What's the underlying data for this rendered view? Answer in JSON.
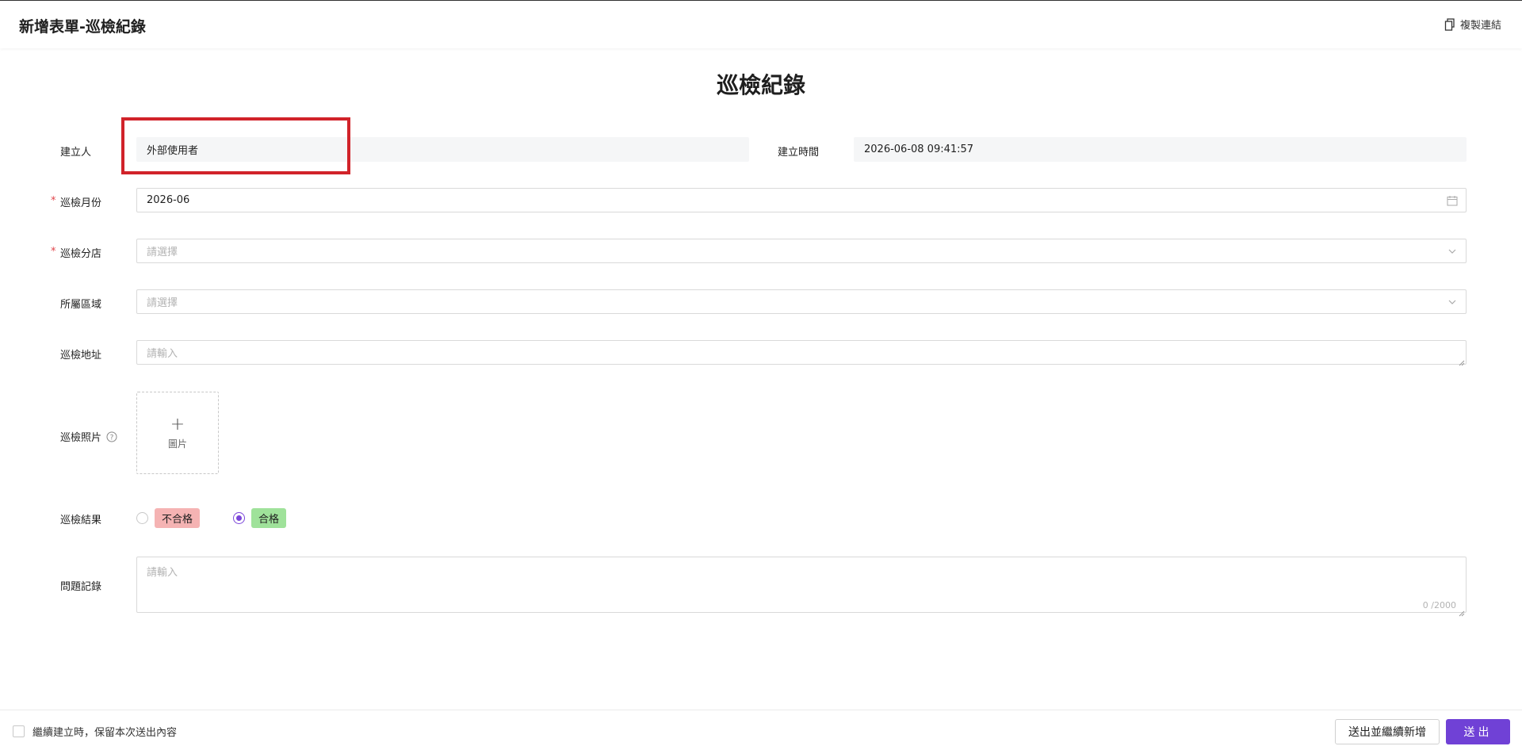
{
  "header": {
    "title": "新增表單-巡檢紀錄",
    "copy_link_label": "複製連結"
  },
  "form": {
    "title": "巡檢紀錄",
    "creator": {
      "label": "建立人",
      "value": "外部使用者"
    },
    "created_time": {
      "label": "建立時間",
      "value": "2026-06-08 09:41:57"
    },
    "month": {
      "label": "巡檢月份",
      "value": "2026-06",
      "required": true
    },
    "branch": {
      "label": "巡檢分店",
      "placeholder": "請選擇",
      "required": true
    },
    "region": {
      "label": "所屬區域",
      "placeholder": "請選擇"
    },
    "address": {
      "label": "巡檢地址",
      "placeholder": "請輸入"
    },
    "photo": {
      "label": "巡檢照片",
      "upload_label": "圖片"
    },
    "result": {
      "label": "巡檢結果",
      "options": [
        "不合格",
        "合格"
      ],
      "selected": "合格"
    },
    "issues": {
      "label": "問題記錄",
      "placeholder": "請輸入",
      "counter": "0 /2000"
    }
  },
  "footer": {
    "keep_label": "繼續建立時，保留本次送出內容",
    "submit_continue_label": "送出並繼續新增",
    "submit_label": "送出"
  },
  "colors": {
    "primary": "#7041d6",
    "required": "#e0454b",
    "highlight": "#d1232a",
    "tag_fail": "#f5b3b3",
    "tag_pass": "#9fe29a"
  }
}
